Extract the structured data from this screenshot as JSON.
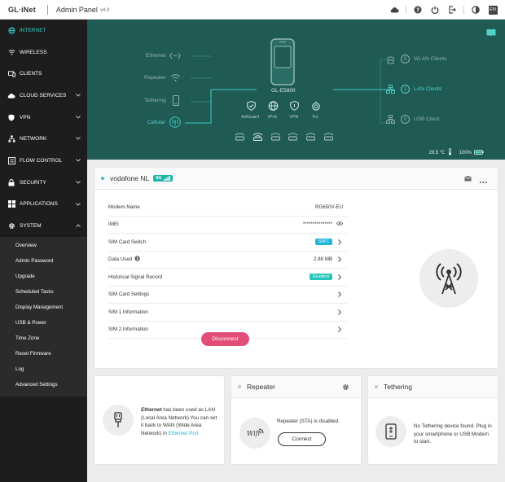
{
  "header": {
    "logo": "GL·iNet",
    "title": "Admin Panel",
    "version": "v4.0",
    "language": "EN",
    "icons": [
      "cloud-icon",
      "help-icon",
      "power-icon",
      "logout-icon",
      "theme-icon"
    ]
  },
  "sidebar": {
    "items": [
      {
        "label": "INTERNET",
        "icon": "internet-icon",
        "active": true
      },
      {
        "label": "WIRELESS",
        "icon": "wifi-icon"
      },
      {
        "label": "CLIENTS",
        "icon": "clients-icon"
      },
      {
        "label": "CLOUD SERVICES",
        "icon": "cloud-icon",
        "expandable": true
      },
      {
        "label": "VPN",
        "icon": "shield-icon",
        "expandable": true
      },
      {
        "label": "NETWORK",
        "icon": "network-icon",
        "expandable": true
      },
      {
        "label": "FLOW CONTROL",
        "icon": "flow-icon",
        "expandable": true
      },
      {
        "label": "SECURITY",
        "icon": "lock-icon",
        "expandable": true
      },
      {
        "label": "APPLICATIONS",
        "icon": "apps-icon",
        "expandable": true
      },
      {
        "label": "SYSTEM",
        "icon": "gear-icon",
        "expanded": true
      }
    ],
    "system_sub": [
      "Overview",
      "Admin Password",
      "Upgrade",
      "Scheduled Tasks",
      "Display Management",
      "USB & Power",
      "Time Zone",
      "Reset Firmware",
      "Log",
      "Advanced Settings"
    ]
  },
  "hero": {
    "inputs": [
      "Ethernet",
      "Repeater",
      "Tethering",
      "Cellular"
    ],
    "device": "GL-E5800",
    "services": [
      "AdGuard",
      "IPv6",
      "VPN",
      "Tor"
    ],
    "outputs": [
      {
        "count": "0",
        "label": "WLAN Clients"
      },
      {
        "count": "1",
        "label": "LAN Clients"
      },
      {
        "count": "0",
        "label": "USB Client"
      }
    ],
    "temperature": "29.5 ℃",
    "battery": "100%"
  },
  "cellular": {
    "carrier": "vodafone NL",
    "badge": "5G",
    "rows": [
      {
        "label": "Modem Name",
        "value": "RG650V-EU"
      },
      {
        "label": "IMEI",
        "value": "***************"
      },
      {
        "label": "SIM Card Switch",
        "pill": "SIM 1"
      },
      {
        "label": "Data Used",
        "value": "2.88 MB"
      },
      {
        "label": "Historical Signal Record",
        "pill": "Excellent"
      },
      {
        "label": "SIM Card Settings"
      },
      {
        "label": "SIM 1 Information"
      },
      {
        "label": "SIM 2 Information"
      }
    ],
    "disconnect": "Disconnect"
  },
  "ethernet": {
    "name": "Ethernet",
    "text": " has been used as LAN (Local Area Network).You can set it back to WAN (Wide Area Network) in ",
    "link": "Ethernet Port"
  },
  "repeater": {
    "title": "Repeater",
    "status": "Repeater (STA) is disabled.",
    "button": "Connect"
  },
  "tethering": {
    "title": "Tethering",
    "status": "No Tethering device found. Plug in your smartphone or USB Modem to start."
  },
  "colors": {
    "accent": "#3ecdc8",
    "hero_bg": "#1f5a53",
    "disconnect": "#e34e78",
    "pill": "#1fb5d6"
  }
}
